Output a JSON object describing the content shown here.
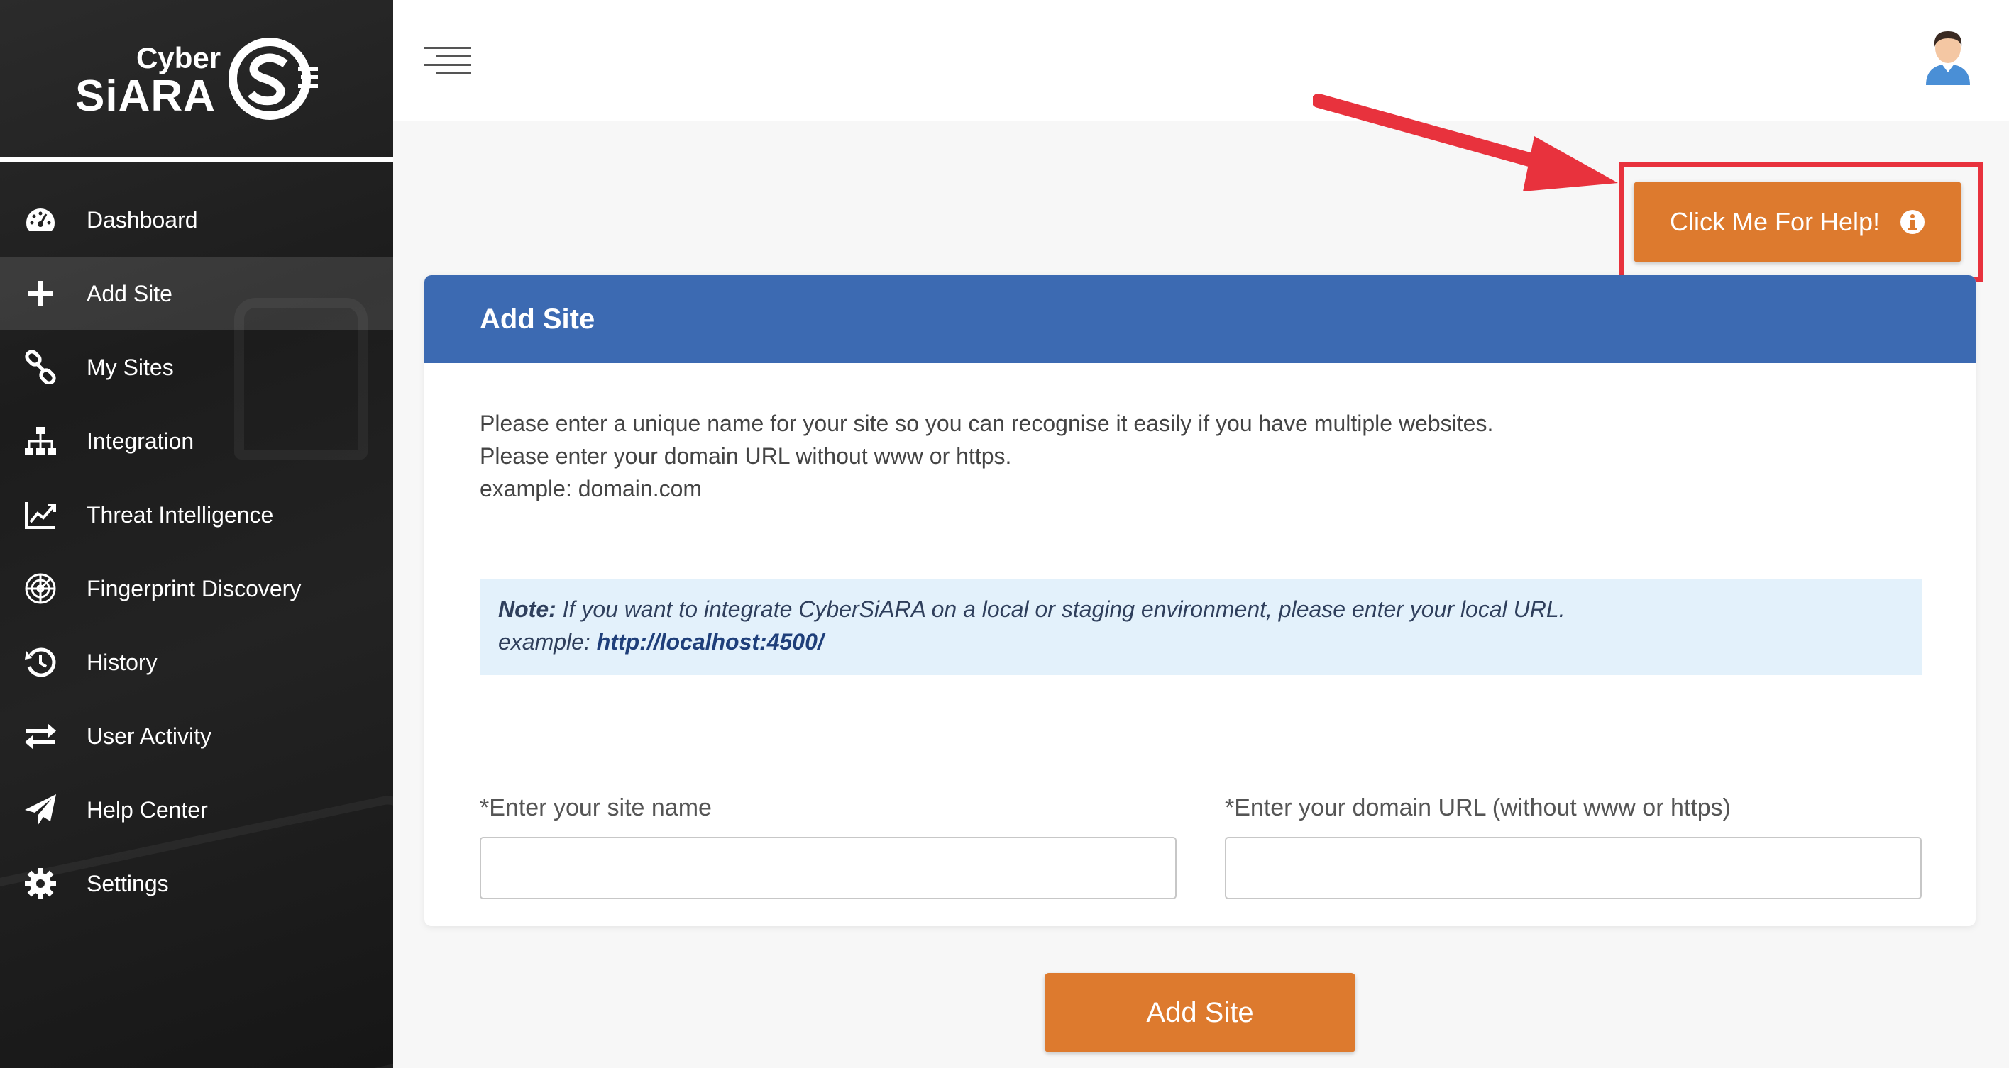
{
  "brand": {
    "line1": "Cyber",
    "line2": "SiARA",
    "accent_color": "#dd7a2e",
    "header_color": "#3c6ab2"
  },
  "sidebar": {
    "items": [
      {
        "label": "Dashboard",
        "icon": "dashboard-icon",
        "active": false
      },
      {
        "label": "Add Site",
        "icon": "plus-icon",
        "active": true
      },
      {
        "label": "My Sites",
        "icon": "link-icon",
        "active": false
      },
      {
        "label": "Integration",
        "icon": "sitemap-icon",
        "active": false
      },
      {
        "label": "Threat Intelligence",
        "icon": "line-chart-icon",
        "active": false
      },
      {
        "label": "Fingerprint Discovery",
        "icon": "radar-icon",
        "active": false
      },
      {
        "label": "History",
        "icon": "history-icon",
        "active": false
      },
      {
        "label": "User Activity",
        "icon": "exchange-icon",
        "active": false
      },
      {
        "label": "Help Center",
        "icon": "paper-plane-icon",
        "active": false
      },
      {
        "label": "Settings",
        "icon": "gear-icon",
        "active": false
      }
    ]
  },
  "header": {
    "menu_icon": "hamburger-menu-icon",
    "avatar_icon": "user-avatar-icon"
  },
  "help_button": {
    "label": "Click Me For Help!",
    "icon": "info-icon"
  },
  "card": {
    "title": "Add Site",
    "instructions": [
      "Please enter a unique name for your site so you can recognise it easily if you have multiple websites.",
      "Please enter your domain URL without www or https.",
      "example: domain.com"
    ],
    "note": {
      "prefix": "Note:",
      "text": " If you want to integrate CyberSiARA on a local or staging environment, please enter your local URL.",
      "example_prefix": "example: ",
      "example_url": "http://localhost:4500/"
    },
    "fields": {
      "site_name": {
        "label": "*Enter your site name",
        "value": "",
        "placeholder": ""
      },
      "domain_url": {
        "label": "*Enter your domain URL (without www or https)",
        "value": "",
        "placeholder": ""
      }
    }
  },
  "submit": {
    "label": "Add Site"
  }
}
